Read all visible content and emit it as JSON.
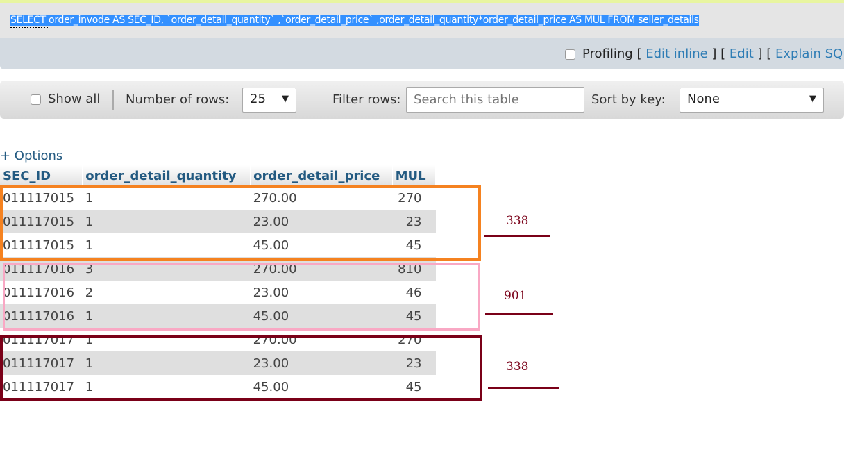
{
  "query": {
    "sql": "SELECT order_invode AS SEC_ID, `order_detail_quantity` ,`order_detail_price` ,order_detail_quantity*order_detail_price AS MUL FROM seller_details"
  },
  "links": {
    "profiling": "Profiling",
    "edit_inline": "Edit inline",
    "edit": "Edit",
    "explain": "Explain SQL"
  },
  "toolbar": {
    "show_all": "Show all",
    "rows_label": "Number of rows:",
    "rows_value": "25",
    "filter_label": "Filter rows:",
    "filter_placeholder": "Search this table",
    "sort_label": "Sort by key:",
    "sort_value": "None"
  },
  "options": "+ Options",
  "table": {
    "columns": [
      "SEC_ID",
      "order_detail_quantity",
      "order_detail_price",
      "MUL"
    ],
    "rows": [
      [
        "011117015",
        "1",
        "270.00",
        "270"
      ],
      [
        "011117015",
        "1",
        "23.00",
        "23"
      ],
      [
        "011117015",
        "1",
        "45.00",
        "45"
      ],
      [
        "011117016",
        "3",
        "270.00",
        "810"
      ],
      [
        "011117016",
        "2",
        "23.00",
        "46"
      ],
      [
        "011117016",
        "1",
        "45.00",
        "45"
      ],
      [
        "011117017",
        "1",
        "270.00",
        "270"
      ],
      [
        "011117017",
        "1",
        "23.00",
        "23"
      ],
      [
        "011117017",
        "1",
        "45.00",
        "45"
      ]
    ]
  },
  "annotations": [
    {
      "text": "338",
      "color": "#f58220"
    },
    {
      "text": "901",
      "color": "#f9a8c4"
    },
    {
      "text": "338",
      "color": "#7a0018"
    }
  ]
}
